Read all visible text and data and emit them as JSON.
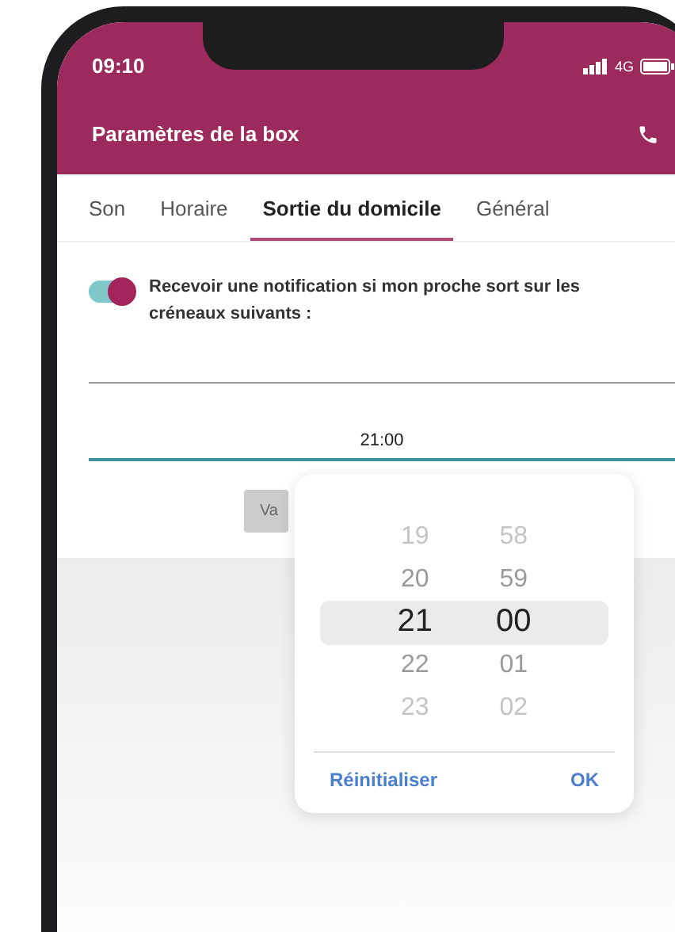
{
  "status_bar": {
    "time": "09:10",
    "network": "4G"
  },
  "header": {
    "title": "Paramètres de la box"
  },
  "tabs": [
    {
      "label": "Son",
      "selected": false
    },
    {
      "label": "Horaire",
      "selected": false
    },
    {
      "label": "Sortie du domicile",
      "selected": true
    },
    {
      "label": "Général",
      "selected": false
    }
  ],
  "notification": {
    "on": true,
    "label": "Recevoir une notification si mon proche sort sur les créneaux suivants :"
  },
  "time_field": {
    "value": "21:00"
  },
  "validate_button": {
    "label": "Va"
  },
  "picker": {
    "columns": [
      {
        "items": [
          {
            "label": "19",
            "selected": false
          },
          {
            "label": "20",
            "selected": false
          },
          {
            "label": "21",
            "selected": true
          },
          {
            "label": "22",
            "selected": false
          },
          {
            "label": "23",
            "selected": false
          }
        ]
      },
      {
        "items": [
          {
            "label": "58",
            "selected": false
          },
          {
            "label": "59",
            "selected": false
          },
          {
            "label": "00",
            "selected": true
          },
          {
            "label": "01",
            "selected": false
          },
          {
            "label": "02",
            "selected": false
          }
        ]
      }
    ],
    "buttons": [
      {
        "label": "Réinitialiser"
      },
      {
        "label": "OK"
      }
    ]
  }
}
